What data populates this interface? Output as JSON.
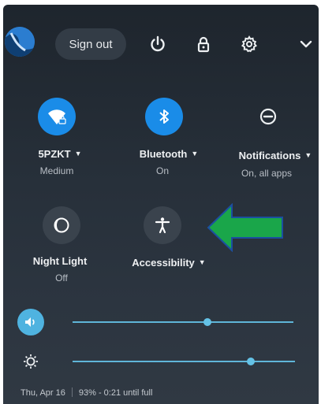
{
  "header": {
    "sign_out_label": "Sign out",
    "icons": [
      "user-avatar",
      "power-icon",
      "lock-icon",
      "gear-icon",
      "chevron-down-icon"
    ]
  },
  "tiles": [
    {
      "label": "5PZKT",
      "sub": "Medium",
      "state": "on",
      "icon": "wifi-lock-icon"
    },
    {
      "label": "Bluetooth",
      "sub": "On",
      "state": "on",
      "icon": "bluetooth-icon"
    },
    {
      "label": "Notifications",
      "sub": "On, all apps",
      "state": "plain",
      "icon": "do-not-disturb-icon"
    },
    {
      "label": "Night Light",
      "sub": "Off",
      "state": "off",
      "icon": "moon-icon"
    },
    {
      "label": "Accessibility",
      "sub": "",
      "state": "off",
      "icon": "accessibility-icon"
    }
  ],
  "sliders": {
    "volume": {
      "value_pct": 61,
      "icon": "speaker-icon"
    },
    "brightness": {
      "value_pct": 80,
      "icon": "brightness-icon"
    }
  },
  "footer": {
    "date": "Thu, Apr 16",
    "battery": "93% - 0:21 until full"
  },
  "colors": {
    "accent": "#1a8ce8",
    "slider": "#5fb6d9",
    "annotation_arrow": "#1aa64a"
  }
}
